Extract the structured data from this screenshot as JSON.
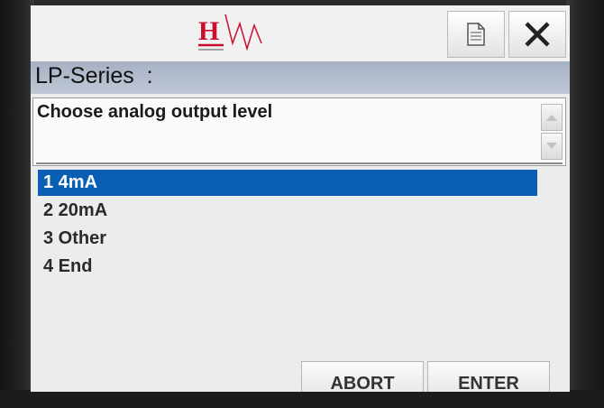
{
  "header": {
    "title": "LP-Series  :"
  },
  "prompt": {
    "text": "Choose analog output level"
  },
  "options": [
    {
      "label": "1 4mA",
      "selected": true
    },
    {
      "label": "2 20mA",
      "selected": false
    },
    {
      "label": "3 Other",
      "selected": false
    },
    {
      "label": "4 End",
      "selected": false
    }
  ],
  "buttons": {
    "abort": "ABORT",
    "enter": "ENTER"
  },
  "colors": {
    "selection": "#0a5fb4",
    "header_bar": "#b3bccc",
    "logo_red": "#c8102e"
  },
  "icons": {
    "logo": "hw-logo",
    "doc": "document-icon",
    "close": "close-icon",
    "up": "scroll-up-icon",
    "down": "scroll-down-icon"
  }
}
